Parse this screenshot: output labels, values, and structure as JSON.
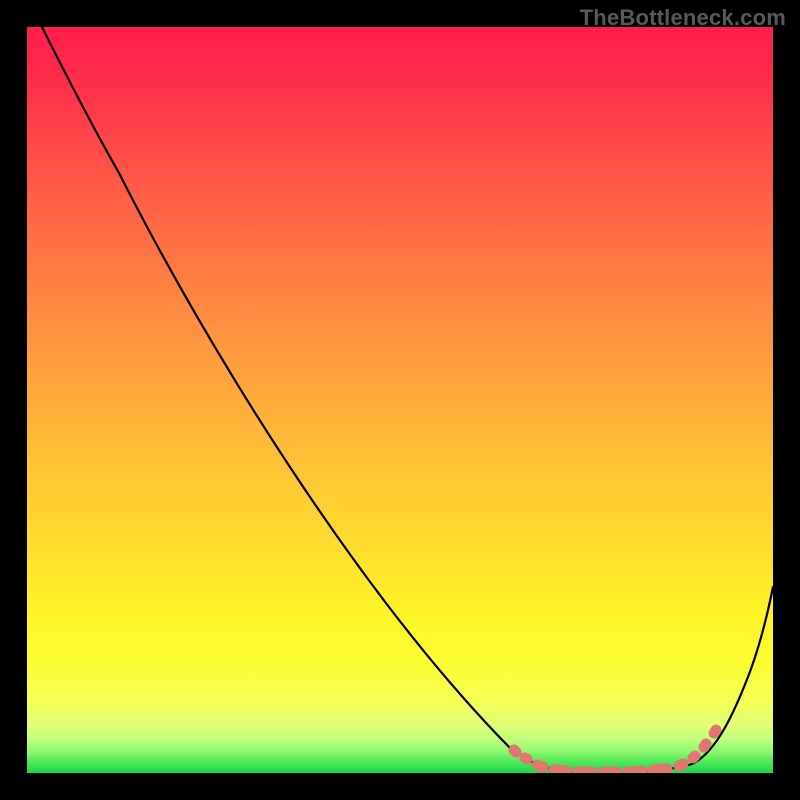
{
  "attribution": "TheBottleneck.com",
  "chart_data": {
    "type": "line",
    "title": "",
    "xlabel": "",
    "ylabel": "",
    "xlim": [
      0,
      1
    ],
    "ylim": [
      0,
      1
    ],
    "background_gradient": {
      "direction": "vertical",
      "stops": [
        {
          "pos": 0.0,
          "color": "#ff1f4b"
        },
        {
          "pos": 0.28,
          "color": "#ff6e45"
        },
        {
          "pos": 0.55,
          "color": "#ffb938"
        },
        {
          "pos": 0.78,
          "color": "#fff227"
        },
        {
          "pos": 0.935,
          "color": "#e2ff76"
        },
        {
          "pos": 1.0,
          "color": "#17d94b"
        }
      ]
    },
    "series": [
      {
        "name": "bottleneck-curve",
        "color": "#000000",
        "x": [
          0.02,
          0.06,
          0.12,
          0.24,
          0.36,
          0.48,
          0.58,
          0.65,
          0.7,
          0.74,
          0.78,
          0.82,
          0.86,
          0.89,
          0.92,
          0.95,
          0.98,
          1.0
        ],
        "y": [
          1.0,
          0.92,
          0.8,
          0.58,
          0.4,
          0.24,
          0.12,
          0.05,
          0.02,
          0.005,
          0.002,
          0.002,
          0.004,
          0.015,
          0.05,
          0.12,
          0.2,
          0.25
        ]
      }
    ],
    "annotations": [
      {
        "name": "optimal-range",
        "style": "dotted-highlight",
        "color": "#e0766f",
        "x_range": [
          0.65,
          0.93
        ],
        "description": "flat valley region marked with salmon dots/segments"
      }
    ]
  }
}
